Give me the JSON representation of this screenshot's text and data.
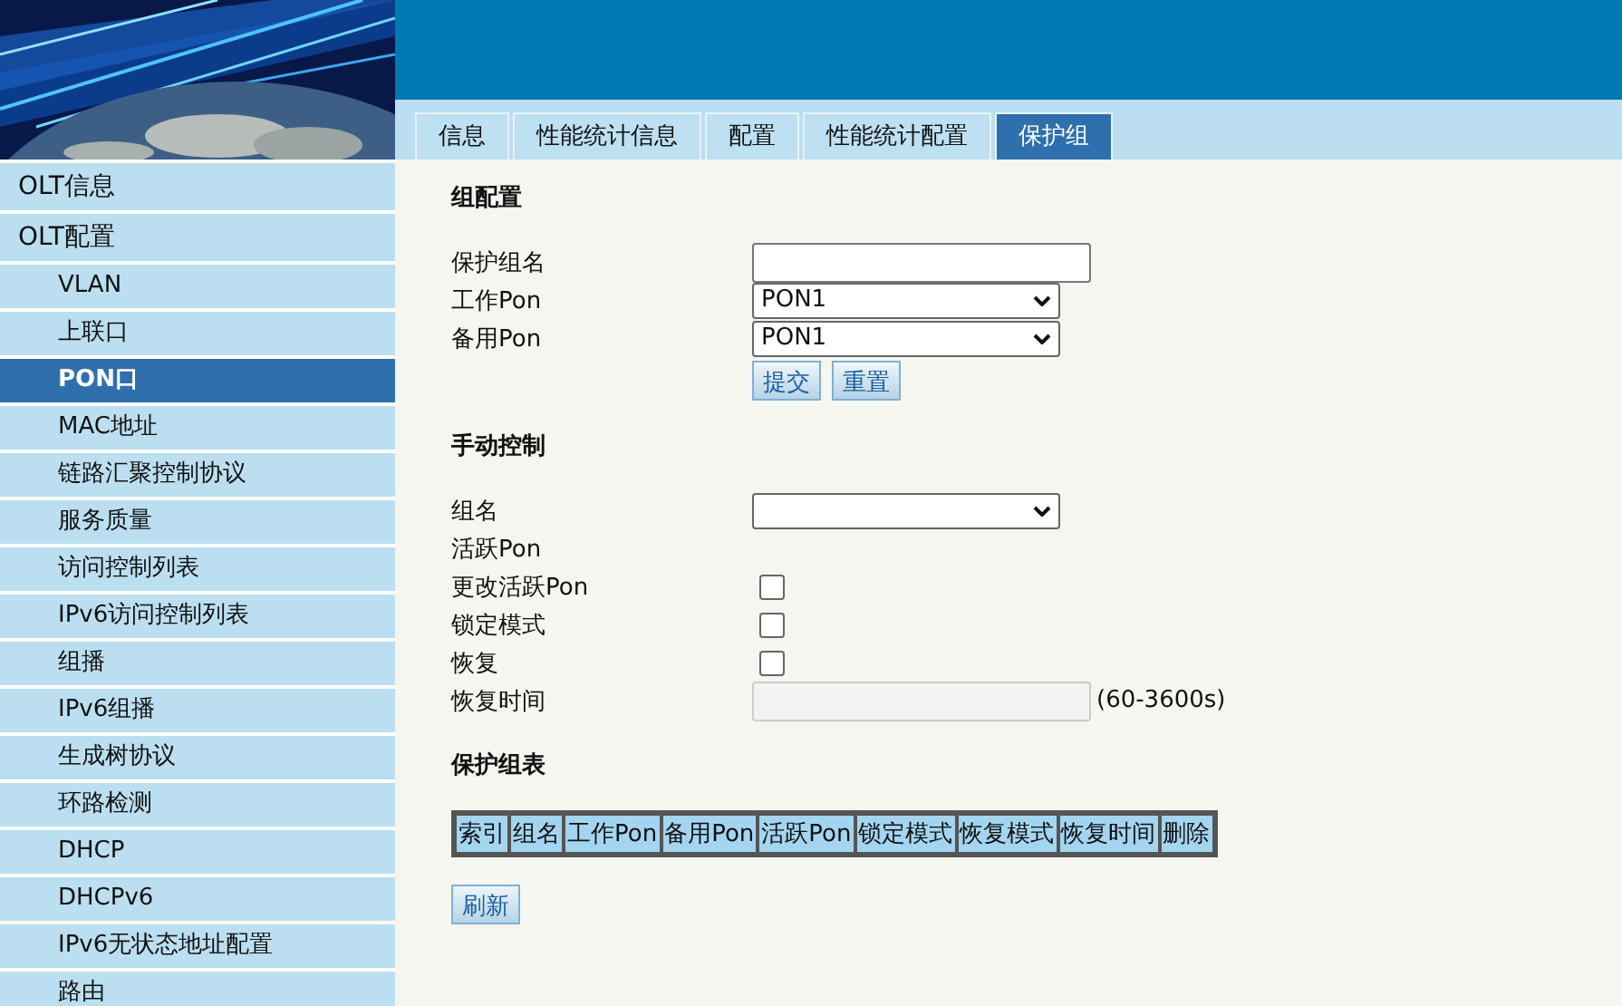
{
  "sidebar": {
    "items": [
      {
        "label": "OLT信息",
        "kind": "group",
        "selected": false
      },
      {
        "label": "OLT配置",
        "kind": "group",
        "selected": false
      },
      {
        "label": "VLAN",
        "kind": "item",
        "selected": false
      },
      {
        "label": "上联口",
        "kind": "item",
        "selected": false
      },
      {
        "label": "PON口",
        "kind": "item",
        "selected": true
      },
      {
        "label": "MAC地址",
        "kind": "item",
        "selected": false
      },
      {
        "label": "链路汇聚控制协议",
        "kind": "item",
        "selected": false
      },
      {
        "label": "服务质量",
        "kind": "item",
        "selected": false
      },
      {
        "label": "访问控制列表",
        "kind": "item",
        "selected": false
      },
      {
        "label": "IPv6访问控制列表",
        "kind": "item",
        "selected": false
      },
      {
        "label": "组播",
        "kind": "item",
        "selected": false
      },
      {
        "label": "IPv6组播",
        "kind": "item",
        "selected": false
      },
      {
        "label": "生成树协议",
        "kind": "item",
        "selected": false
      },
      {
        "label": "环路检测",
        "kind": "item",
        "selected": false
      },
      {
        "label": "DHCP",
        "kind": "item",
        "selected": false
      },
      {
        "label": "DHCPv6",
        "kind": "item",
        "selected": false
      },
      {
        "label": "IPv6无状态地址配置",
        "kind": "item",
        "selected": false
      },
      {
        "label": "路由",
        "kind": "item",
        "selected": false
      }
    ]
  },
  "tabs": [
    {
      "label": "信息",
      "selected": false
    },
    {
      "label": "性能统计信息",
      "selected": false
    },
    {
      "label": "配置",
      "selected": false
    },
    {
      "label": "性能统计配置",
      "selected": false
    },
    {
      "label": "保护组",
      "selected": true
    }
  ],
  "group_config": {
    "title": "组配置",
    "fields": [
      {
        "label": "保护组名",
        "kind": "text"
      },
      {
        "label": "工作Pon",
        "kind": "select",
        "value": "PON1"
      },
      {
        "label": "备用Pon",
        "kind": "select",
        "value": "PON1"
      }
    ],
    "buttons": [
      "提交",
      "重置"
    ]
  },
  "manual_control": {
    "title": "手动控制",
    "fields": [
      {
        "label": "组名",
        "kind": "select"
      },
      {
        "label": "活跃Pon",
        "kind": "none"
      },
      {
        "label": "更改活跃Pon",
        "kind": "checkbox",
        "checked": false
      },
      {
        "label": "锁定模式",
        "kind": "checkbox",
        "checked": false
      },
      {
        "label": "恢复",
        "kind": "checkbox",
        "checked": false
      },
      {
        "label": "恢复时间",
        "kind": "text",
        "disabled": true,
        "suffix": "(60-3600s)"
      }
    ]
  },
  "protection_table": {
    "title": "保护组表",
    "columns": [
      "索引",
      "组名",
      "工作Pon",
      "备用Pon",
      "活跃Pon",
      "锁定模式",
      "恢复模式",
      "恢复时间",
      "删除"
    ],
    "buttons": [
      "刷新"
    ]
  }
}
